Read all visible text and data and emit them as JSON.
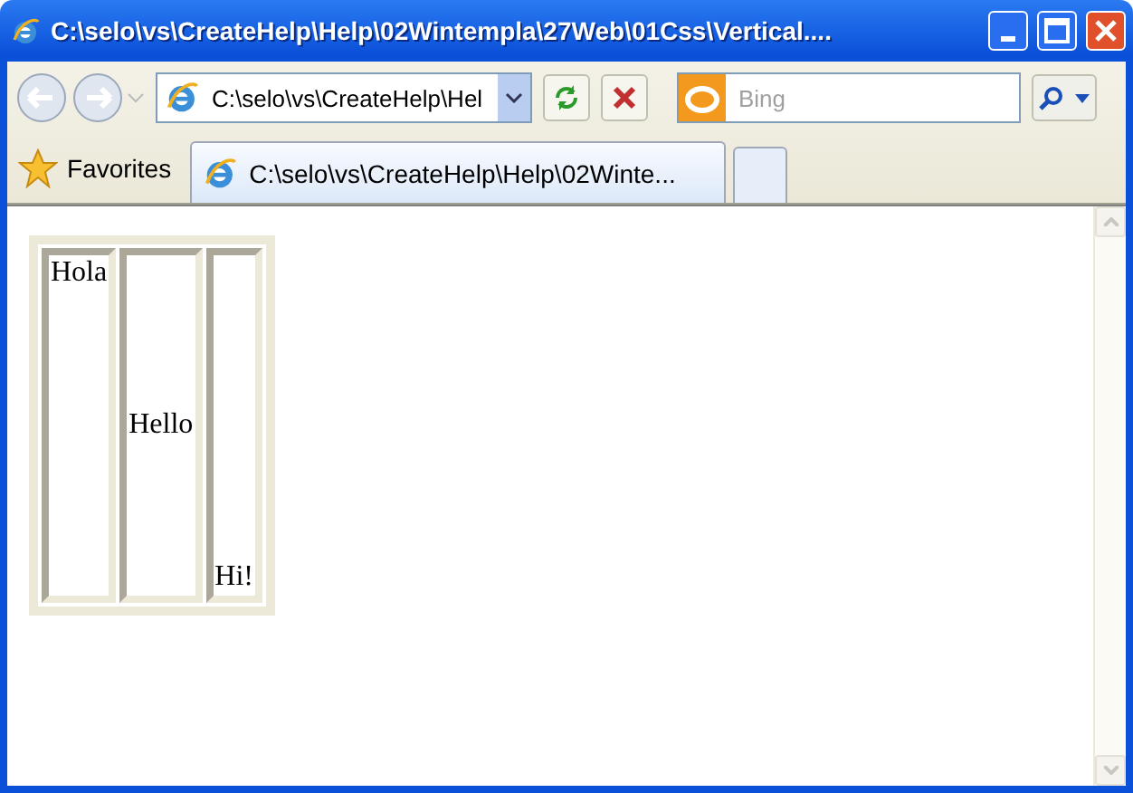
{
  "window": {
    "title": "C:\\selo\\vs\\CreateHelp\\Help\\02Wintempla\\27Web\\01Css\\Vertical...."
  },
  "address_bar": {
    "value": "C:\\selo\\vs\\CreateHelp\\Hel"
  },
  "search": {
    "placeholder": "Bing"
  },
  "favorites": {
    "label": "Favorites"
  },
  "tabs": [
    {
      "label": "C:\\selo\\vs\\CreateHelp\\Help\\02Winte...",
      "selected": true
    }
  ],
  "table": {
    "cells": [
      {
        "text": "Hola",
        "kind": "top"
      },
      {
        "text": "Hello",
        "kind": "middle"
      },
      {
        "text": "Hi!",
        "kind": "bottom"
      }
    ]
  }
}
